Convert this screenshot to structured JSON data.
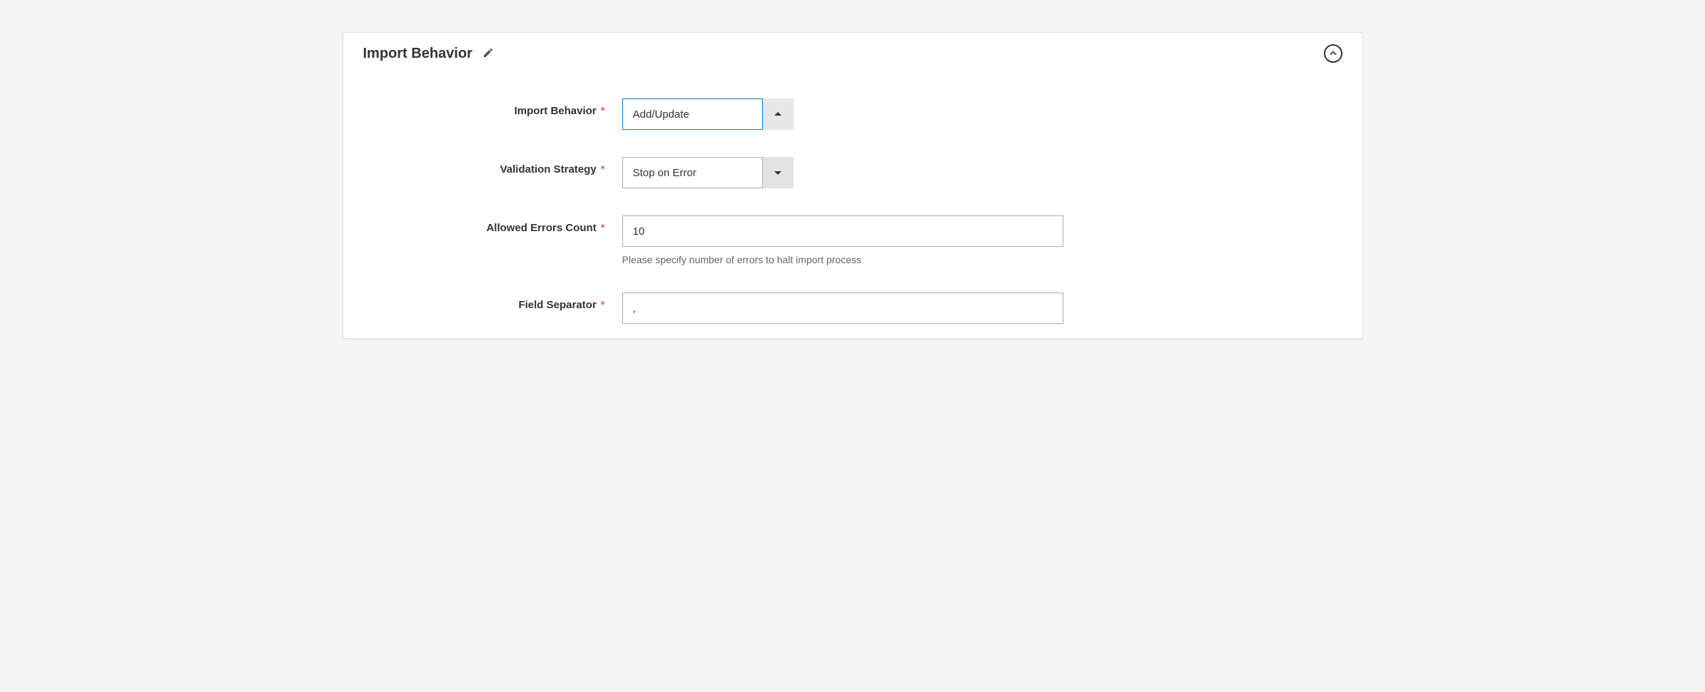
{
  "section": {
    "title": "Import Behavior"
  },
  "form": {
    "import_behavior": {
      "label": "Import Behavior",
      "value": "Add/Update"
    },
    "validation_strategy": {
      "label": "Validation Strategy",
      "value": "Stop on Error"
    },
    "allowed_errors_count": {
      "label": "Allowed Errors Count",
      "value": "10",
      "hint": "Please specify number of errors to halt import process"
    },
    "field_separator": {
      "label": "Field Separator",
      "value": ","
    }
  }
}
